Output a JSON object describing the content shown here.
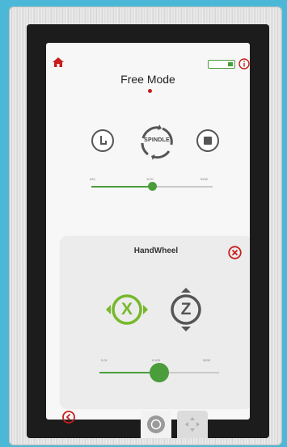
{
  "screen": {
    "title": "Free Mode",
    "spindle_label": "SPINDLE",
    "speed_slider": {
      "ticks": [
        "520",
        "1170",
        "5200"
      ],
      "value_fraction": 0.5
    }
  },
  "handwheel": {
    "title": "HandWheel",
    "axes": [
      {
        "label": "X",
        "selected": true
      },
      {
        "label": "Z",
        "selected": false
      }
    ],
    "slider": {
      "ticks": [
        "0.01",
        "0.100",
        "5200"
      ],
      "value_fraction": 0.5
    }
  },
  "colors": {
    "accent_red": "#c81e1e",
    "accent_green": "#4a9d3a",
    "icon_gray": "#555555"
  },
  "icons": {
    "home": "home-icon",
    "battery": "battery-icon",
    "info": "info-icon",
    "close": "close-icon",
    "back": "back-icon",
    "jog": "jog-icon",
    "direction": "direction-pad-icon"
  }
}
